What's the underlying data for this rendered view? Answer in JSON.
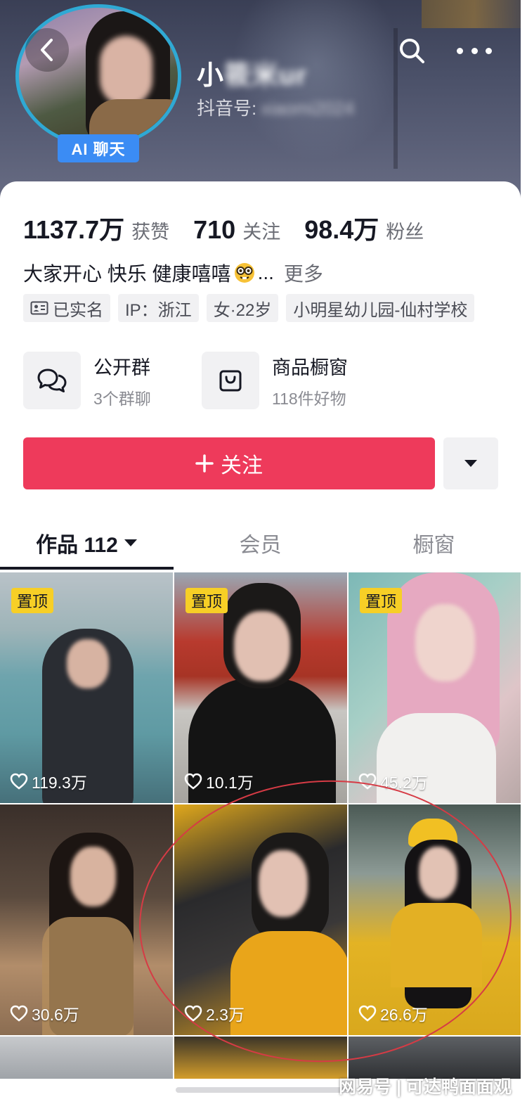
{
  "header": {
    "ai_badge": "AI 聊天",
    "nickname_visible": "小",
    "nickname_blurred": "筱米ur",
    "id_label": "抖音号:",
    "id_blurred": "xiaomi2024"
  },
  "stats": [
    {
      "num": "1137.7万",
      "label": "获赞"
    },
    {
      "num": "710",
      "label": "关注"
    },
    {
      "num": "98.4万",
      "label": "粉丝"
    }
  ],
  "bio": {
    "text": "大家开心 快乐 健康嘻嘻",
    "ellipsis": "...",
    "more": "更多",
    "emoji": "nerd-face-icon"
  },
  "tags": [
    {
      "text": "已实名",
      "icon": "id-card-icon"
    },
    {
      "text": "IP：浙江"
    },
    {
      "text": "女·22岁"
    },
    {
      "text": "小明星幼儿园-仙村学校"
    }
  ],
  "features": [
    {
      "title": "公开群",
      "sub": "3个群聊",
      "icon": "chat-bubbles-icon"
    },
    {
      "title": "商品橱窗",
      "sub": "118件好物",
      "icon": "shopping-bag-icon"
    }
  ],
  "follow_button": {
    "label": "关注"
  },
  "tabs": [
    {
      "label": "作品 112",
      "active": true
    },
    {
      "label": "会员",
      "active": false
    },
    {
      "label": "橱窗",
      "active": false
    }
  ],
  "videos": [
    {
      "pinned": "置顶",
      "likes": "119.3万"
    },
    {
      "pinned": "置顶",
      "likes": "10.1万"
    },
    {
      "pinned": "置顶",
      "likes": "45.2万"
    },
    {
      "likes": "30.6万"
    },
    {
      "likes": "2.3万"
    },
    {
      "likes": "26.6万"
    }
  ],
  "watermark": "网易号 | 可达鸭面面观",
  "colors": {
    "accent": "#ee3a5b",
    "ai_badge": "#3b8cf4",
    "pin_badge": "#f7cf26",
    "highlight_ring": "#d63b45",
    "avatar_ring": "#2fa9d4"
  }
}
